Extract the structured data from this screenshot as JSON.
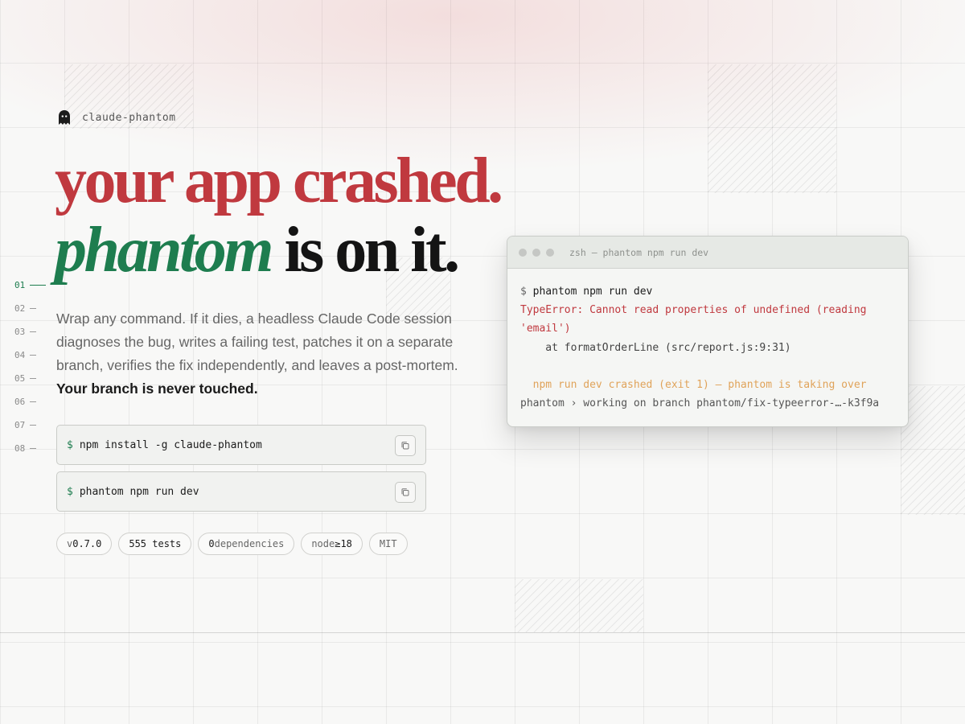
{
  "brand": {
    "name": "claude-phantom",
    "icon": "ghost-icon"
  },
  "headline": {
    "line1": "your app crashed.",
    "line2_emphasis": "phantom",
    "line2_rest": " is on it."
  },
  "line_numbers": [
    "01",
    "02",
    "03",
    "04",
    "05",
    "06",
    "07",
    "08"
  ],
  "description": {
    "text": "Wrap any command. If it dies, a headless Claude Code session diagnoses the bug, writes a failing test, patches it on a separate branch, verifies the fix independently, and leaves a post-mortem. ",
    "bold": "Your branch is never touched."
  },
  "install": [
    {
      "prompt": "$",
      "command": "npm install -g claude-phantom",
      "copy_icon": "copy-icon"
    },
    {
      "prompt": "$",
      "command": "phantom npm run dev",
      "copy_icon": "copy-icon"
    }
  ],
  "badges": {
    "version_prefix": "v",
    "version": "0.7.0",
    "tests": "555 tests",
    "deps_count": "0",
    "deps_label": " dependencies",
    "node_label": "node ",
    "node_version": "≥18",
    "license": "MIT"
  },
  "terminal": {
    "title": "zsh — phantom npm run dev",
    "lines": {
      "prompt": "$ ",
      "command": "phantom npm run dev",
      "error_1": "TypeError: Cannot read properties of undefined (reading",
      "error_2": "'email')",
      "trace": "    at formatOrderLine (src/report.js:9:31)",
      "warn": "  npm run dev crashed (exit 1) — phantom is taking over",
      "info": "phantom › working on branch phantom/fix-typeerror-…-k3f9a"
    }
  },
  "colors": {
    "accent_red": "#c0393f",
    "accent_green": "#1e7d4f",
    "warn_orange": "#e0a35a"
  }
}
